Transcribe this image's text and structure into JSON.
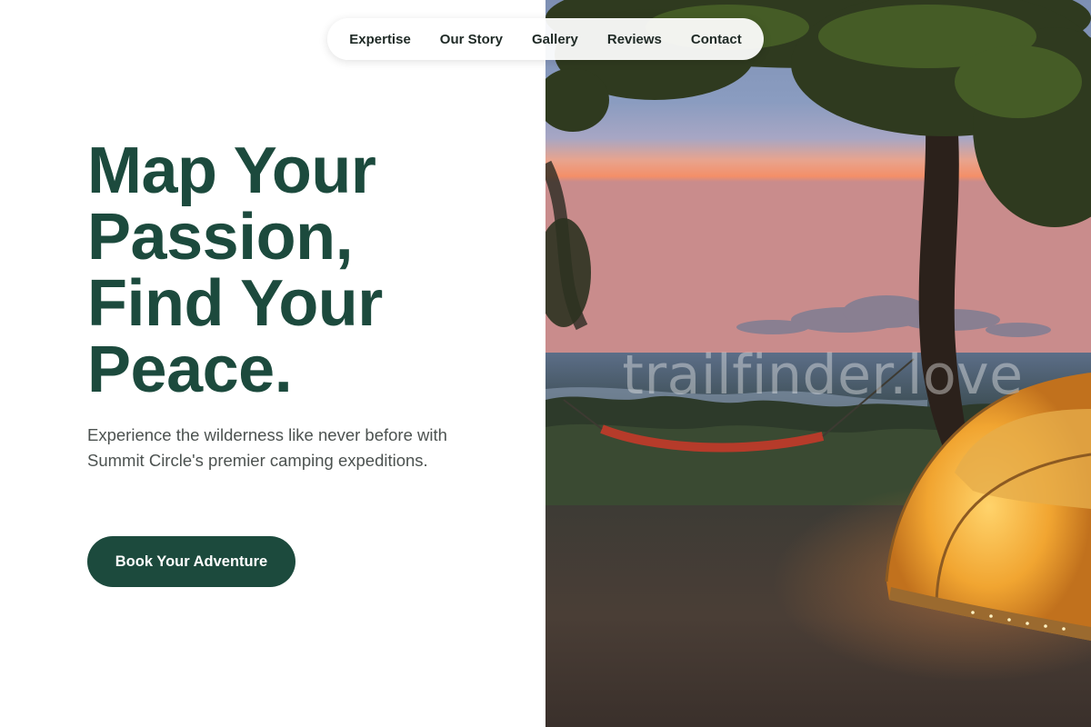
{
  "nav": {
    "items": [
      {
        "label": "Expertise"
      },
      {
        "label": "Our Story"
      },
      {
        "label": "Gallery"
      },
      {
        "label": "Reviews"
      },
      {
        "label": "Contact"
      }
    ]
  },
  "hero": {
    "title_lines": [
      "Map Your",
      "Passion,",
      "Find Your",
      "Peace."
    ],
    "subtitle": "Experience the wilderness like never before with Summit Circle's premier camping expeditions.",
    "cta_label": "Book Your Adventure"
  },
  "image": {
    "watermark": "trailfinder.love",
    "icon": "camping-scene-photo"
  },
  "colors": {
    "brand_green": "#1c4a3d",
    "body_text": "#4c5250",
    "nav_text": "#1f2a26",
    "background": "#ffffff"
  }
}
